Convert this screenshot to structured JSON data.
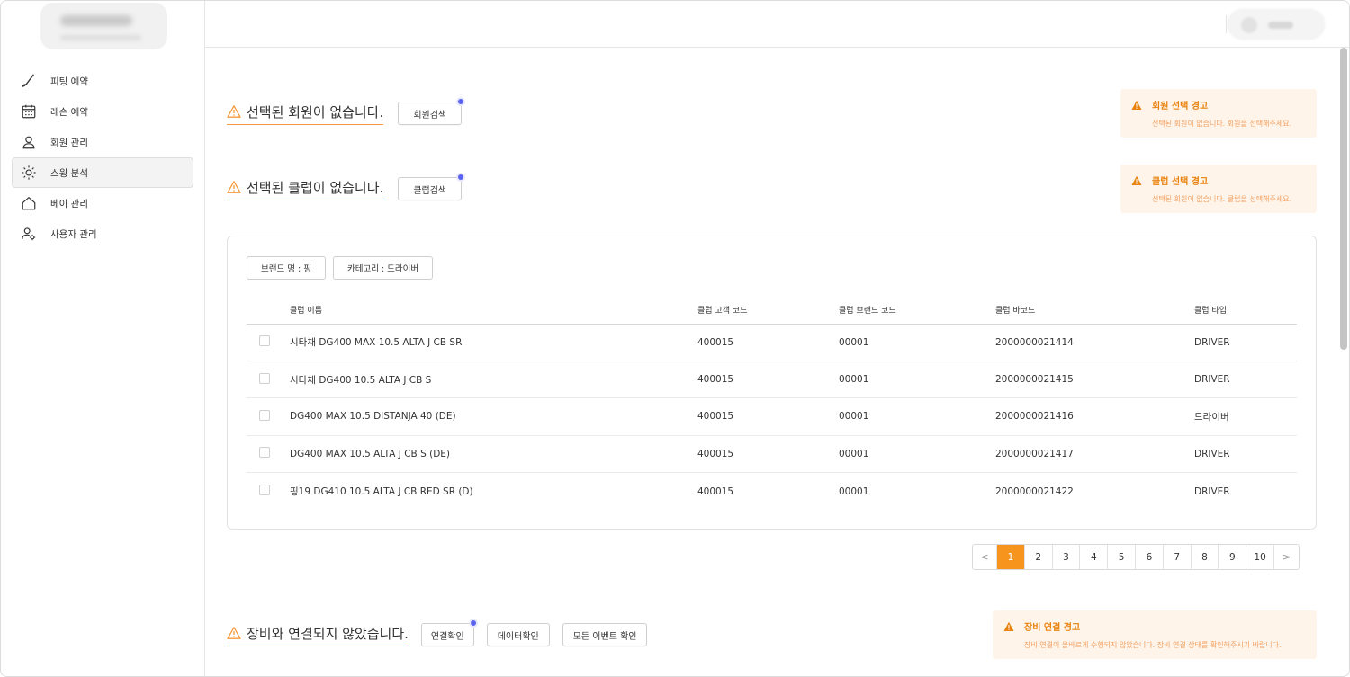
{
  "sidebar": {
    "items": [
      {
        "label": "피팅 예약",
        "icon": "golf-club-icon"
      },
      {
        "label": "레슨 예약",
        "icon": "calendar-icon"
      },
      {
        "label": "회원 관리",
        "icon": "user-icon"
      },
      {
        "label": "스윙 분석",
        "icon": "sun-icon"
      },
      {
        "label": "베이 관리",
        "icon": "house-icon"
      },
      {
        "label": "사용자 관리",
        "icon": "user-settings-icon"
      }
    ],
    "active_index": 3
  },
  "member_status": {
    "title": "선택된 회원이 없습니다.",
    "button": "회원검색",
    "alert_title": "회원 선택 경고",
    "alert_body": "선택된 회원이 없습니다. 회원을 선택해주세요."
  },
  "club_status": {
    "title": "선택된 클럽이 없습니다.",
    "button": "클럽검색",
    "alert_title": "클럽 선택 경고",
    "alert_body": "선택된 회원이 없습니다. 클럽을 선택해주세요."
  },
  "filters": [
    "브랜드 명 : 핑",
    "카테고리 : 드라이버"
  ],
  "table": {
    "headers": [
      "클럽 이름",
      "클럽 고객 코드",
      "클럽 브랜드 코드",
      "클럽 바코드",
      "클럽 타입"
    ],
    "rows": [
      [
        "시타채 DG400 MAX 10.5 ALTA J CB SR",
        "400015",
        "00001",
        "2000000021414",
        "DRIVER"
      ],
      [
        "시타채 DG400 10.5 ALTA J CB S",
        "400015",
        "00001",
        "2000000021415",
        "DRIVER"
      ],
      [
        "DG400 MAX 10.5 DISTANJA 40 (DE)",
        "400015",
        "00001",
        "2000000021416",
        "드라이버"
      ],
      [
        "DG400 MAX 10.5 ALTA J CB S (DE)",
        "400015",
        "00001",
        "2000000021417",
        "DRIVER"
      ],
      [
        "핑19 DG410 10.5 ALTA J CB RED SR (D)",
        "400015",
        "00001",
        "2000000021422",
        "DRIVER"
      ]
    ]
  },
  "pagination": {
    "prev": "<",
    "next": ">",
    "pages": [
      "1",
      "2",
      "3",
      "4",
      "5",
      "6",
      "7",
      "8",
      "9",
      "10"
    ],
    "current": "1"
  },
  "device_status": {
    "title": "장비와 연결되지 않았습니다.",
    "buttons": [
      "연결확인",
      "데이터확인",
      "모든 이벤트 확인"
    ],
    "alert_title": "장비 연결 경고",
    "alert_body": "장비 연결이 올바르게 수행되지 않았습니다. 장비 연결 상태를 확인해주시기 바랍니다."
  },
  "colors": {
    "accent": "#f7941d",
    "warning_text": "#e8820d",
    "alert_bg": "#fff4ea",
    "notify_dot": "#5b63f0"
  }
}
